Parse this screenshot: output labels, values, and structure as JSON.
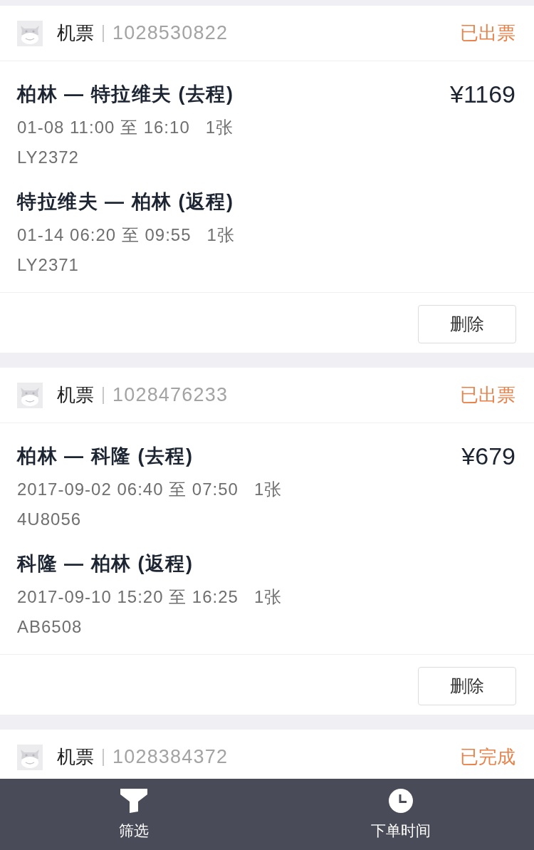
{
  "orders": [
    {
      "category": "机票",
      "order_number": "1028530822",
      "status": "已出票",
      "price": "¥1169",
      "legs": [
        {
          "route": "柏林 — 特拉维夫 (去程)",
          "time": "01-08 11:00 至 16:10",
          "tickets": "1张",
          "flight": "LY2372"
        },
        {
          "route": "特拉维夫 — 柏林 (返程)",
          "time": "01-14 06:20 至 09:55",
          "tickets": "1张",
          "flight": "LY2371"
        }
      ],
      "actions": [
        "删除"
      ]
    },
    {
      "category": "机票",
      "order_number": "1028476233",
      "status": "已出票",
      "price": "¥679",
      "legs": [
        {
          "route": "柏林 — 科隆 (去程)",
          "time": "2017-09-02 06:40 至 07:50",
          "tickets": "1张",
          "flight": "4U8056"
        },
        {
          "route": "科隆 — 柏林 (返程)",
          "time": "2017-09-10 15:20 至 16:25",
          "tickets": "1张",
          "flight": "AB6508"
        }
      ],
      "actions": [
        "删除"
      ]
    },
    {
      "category": "机票",
      "order_number": "1028384372",
      "status": "已完成"
    }
  ],
  "bottom_bar": [
    {
      "kind": "filter",
      "label": "筛选"
    },
    {
      "kind": "clock",
      "label": "下单时间"
    }
  ]
}
